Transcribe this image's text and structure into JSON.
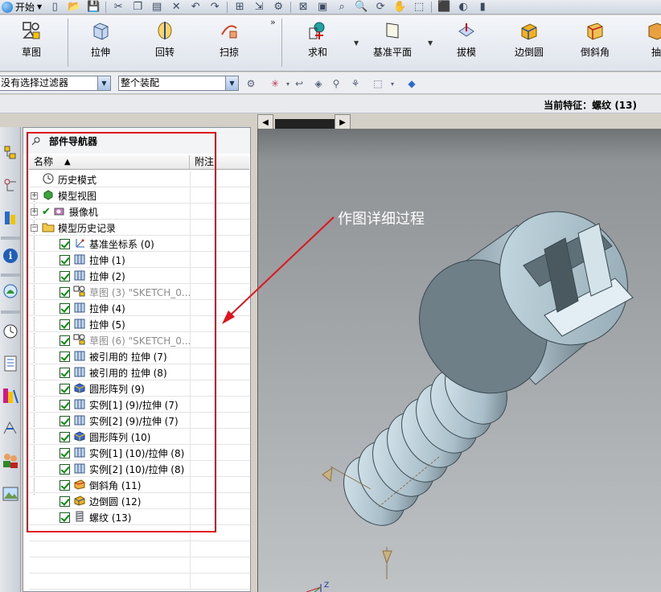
{
  "window": {
    "start_label": "开始"
  },
  "ribbon": {
    "buttons": [
      {
        "label": "草图"
      },
      {
        "label": "拉伸"
      },
      {
        "label": "回转"
      },
      {
        "label": "扫掠"
      },
      {
        "label": "求和"
      },
      {
        "label": "基准平面"
      },
      {
        "label": "拔模"
      },
      {
        "label": "边倒圆"
      },
      {
        "label": "倒斜角"
      },
      {
        "label": "抽"
      }
    ],
    "more": "»"
  },
  "filterbar": {
    "selection_filter": "没有选择过滤器",
    "scope": "整个装配"
  },
  "status": {
    "current_feature": "当前特征：螺纹 (13)"
  },
  "navigator": {
    "title": "部件导航器",
    "columns": {
      "name": "名称",
      "note": "附注"
    },
    "items": [
      {
        "label": "历史模式",
        "icon": "clock-icon",
        "level": 0,
        "expander": "",
        "checked": false,
        "suppressed": false
      },
      {
        "label": "模型视图",
        "icon": "model-view-icon",
        "level": 0,
        "expander": "+",
        "checked": false,
        "suppressed": false
      },
      {
        "label": "摄像机",
        "icon": "camera-icon",
        "level": 0,
        "expander": "+",
        "checked": false,
        "suppressed": false
      },
      {
        "label": "模型历史记录",
        "icon": "folder-icon",
        "level": 0,
        "expander": "-",
        "checked": false,
        "suppressed": false
      },
      {
        "label": "基准坐标系 (0)",
        "icon": "datum-csys-icon",
        "level": 1,
        "expander": "",
        "checked": true,
        "suppressed": false
      },
      {
        "label": "拉伸 (1)",
        "icon": "extrude-icon",
        "level": 1,
        "expander": "",
        "checked": true,
        "suppressed": false
      },
      {
        "label": "拉伸 (2)",
        "icon": "extrude-icon",
        "level": 1,
        "expander": "",
        "checked": true,
        "suppressed": false
      },
      {
        "label": "草图 (3) \"SKETCH_0...",
        "icon": "sketch-icon",
        "level": 1,
        "expander": "",
        "checked": true,
        "suppressed": true
      },
      {
        "label": "拉伸 (4)",
        "icon": "extrude-icon",
        "level": 1,
        "expander": "",
        "checked": true,
        "suppressed": false
      },
      {
        "label": "拉伸 (5)",
        "icon": "extrude-icon",
        "level": 1,
        "expander": "",
        "checked": true,
        "suppressed": false
      },
      {
        "label": "草图 (6) \"SKETCH_0...",
        "icon": "sketch-icon",
        "level": 1,
        "expander": "",
        "checked": true,
        "suppressed": true
      },
      {
        "label": "被引用的 拉伸 (7)",
        "icon": "extrude-icon",
        "level": 1,
        "expander": "",
        "checked": true,
        "suppressed": false
      },
      {
        "label": "被引用的 拉伸 (8)",
        "icon": "extrude-icon",
        "level": 1,
        "expander": "",
        "checked": true,
        "suppressed": false
      },
      {
        "label": "圆形阵列 (9)",
        "icon": "pattern-icon",
        "level": 1,
        "expander": "",
        "checked": true,
        "suppressed": false
      },
      {
        "label": "实例[1] (9)/拉伸 (7)",
        "icon": "extrude-icon",
        "level": 1,
        "expander": "",
        "checked": true,
        "suppressed": false
      },
      {
        "label": "实例[2] (9)/拉伸 (7)",
        "icon": "extrude-icon",
        "level": 1,
        "expander": "",
        "checked": true,
        "suppressed": false
      },
      {
        "label": "圆形阵列 (10)",
        "icon": "pattern-icon",
        "level": 1,
        "expander": "",
        "checked": true,
        "suppressed": false
      },
      {
        "label": "实例[1] (10)/拉伸 (8)",
        "icon": "extrude-icon",
        "level": 1,
        "expander": "",
        "checked": true,
        "suppressed": false
      },
      {
        "label": "实例[2] (10)/拉伸 (8)",
        "icon": "extrude-icon",
        "level": 1,
        "expander": "",
        "checked": true,
        "suppressed": false
      },
      {
        "label": "倒斜角 (11)",
        "icon": "chamfer-icon",
        "level": 1,
        "expander": "",
        "checked": true,
        "suppressed": false
      },
      {
        "label": "边倒圆 (12)",
        "icon": "blend-icon",
        "level": 1,
        "expander": "",
        "checked": true,
        "suppressed": false
      },
      {
        "label": "螺纹 (13)",
        "icon": "thread-icon",
        "level": 1,
        "expander": "",
        "checked": true,
        "suppressed": false
      }
    ]
  },
  "annotation": {
    "text": "作图详细过程",
    "color": "#e0141d"
  },
  "axes": {
    "z": "Z"
  },
  "colors": {
    "highlight": "#e0141d",
    "check": "#0a8a0a",
    "viewport_top": "#6f7375",
    "viewport_bottom": "#bfc3c5"
  }
}
